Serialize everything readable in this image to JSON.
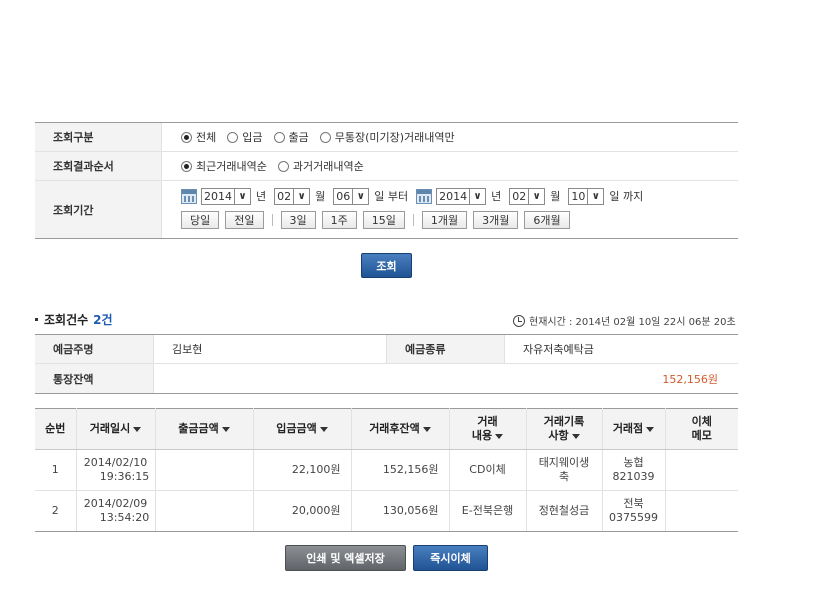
{
  "search_conditions": {
    "type_label": "조회구분",
    "type_options": [
      {
        "label": "전체",
        "checked": true
      },
      {
        "label": "입금",
        "checked": false
      },
      {
        "label": "출금",
        "checked": false
      },
      {
        "label": "무통장(미기장)거래내역만",
        "checked": false
      }
    ],
    "order_label": "조회결과순서",
    "order_options": [
      {
        "label": "최근거래내역순",
        "checked": true
      },
      {
        "label": "과거거래내역순",
        "checked": false
      }
    ],
    "period_label": "조회기간",
    "from": {
      "year": "2014",
      "month": "02",
      "day": "06"
    },
    "to": {
      "year": "2014",
      "month": "02",
      "day": "10"
    },
    "unit_year": "년",
    "unit_month": "월",
    "unit_day_from": "일 부터",
    "unit_day_to": "일 까지",
    "quick_buttons": [
      "당일",
      "전일",
      "3일",
      "1주",
      "15일",
      "1개월",
      "3개월",
      "6개월"
    ]
  },
  "search_button": "조회",
  "result": {
    "count_label": "조회건수",
    "count_value": "2건",
    "current_time": "현재시간 : 2014년 02월 10일 22시 06분 20초"
  },
  "account": {
    "holder_label": "예금주명",
    "holder_value": "김보현",
    "type_label": "예금종류",
    "type_value": "자유저축예탁금",
    "balance_label": "통장잔액",
    "balance_value": "152,156원"
  },
  "table": {
    "headers": {
      "no": "순번",
      "date": "거래일시",
      "withdraw": "출금금액",
      "deposit": "입금금액",
      "balance": "거래후잔액",
      "desc_1": "거래",
      "desc_2": "내용",
      "record_1": "거래기록",
      "record_2": "사항",
      "branch": "거래점",
      "memo_1": "이체",
      "memo_2": "메모"
    },
    "rows": [
      {
        "no": "1",
        "date": "2014/02/10",
        "time": "19:36:15",
        "withdraw": "",
        "deposit": "22,100원",
        "balance": "152,156원",
        "desc": "CD이체",
        "record_1": "태지웨이생",
        "record_2": "축",
        "branch_1": "농협",
        "branch_2": "821039",
        "memo": ""
      },
      {
        "no": "2",
        "date": "2014/02/09",
        "time": "13:54:20",
        "withdraw": "",
        "deposit": "20,000원",
        "balance": "130,056원",
        "desc": "E-전북은행",
        "record_1": "정현철성금",
        "record_2": "",
        "branch_1": "전북",
        "branch_2": "0375599",
        "memo": ""
      }
    ]
  },
  "buttons": {
    "print": "인쇄 및 엑셀저장",
    "transfer": "즉시이체"
  }
}
